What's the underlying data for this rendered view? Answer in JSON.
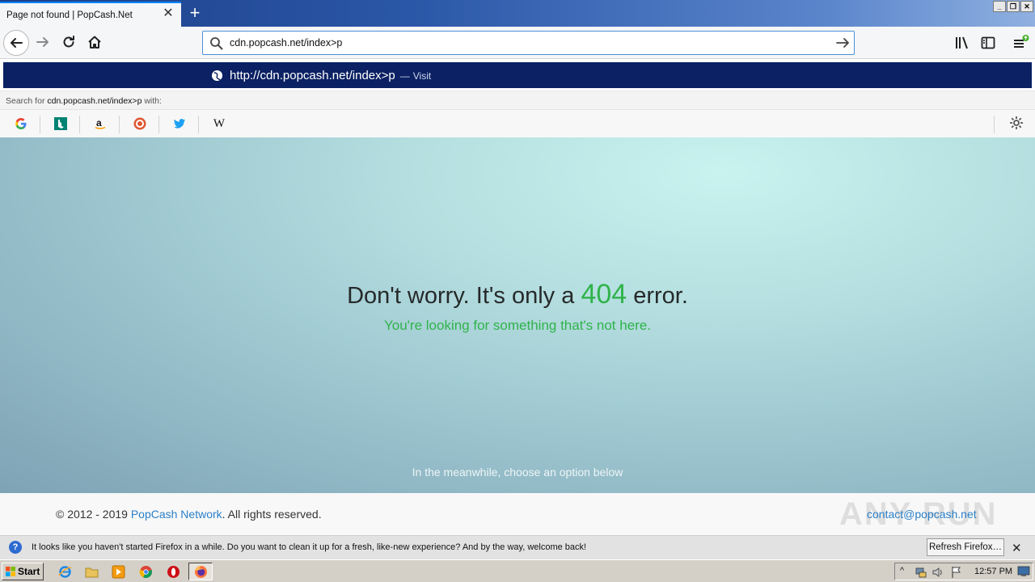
{
  "browser": {
    "tab_title": "Page not found | PopCash.Net",
    "tab_close": "✕",
    "new_tab": "+",
    "window_buttons": [
      "_",
      "❐",
      "✕"
    ],
    "url": "cdn.popcash.net/index>p",
    "autocomplete": {
      "protocol": "http://",
      "host": "cdn.popcash.net",
      "path": "/index>p",
      "separator": "—",
      "action": "Visit"
    },
    "search_for": {
      "prefix": "Search for ",
      "query": "cdn.popcash.net/index>p",
      "suffix": " with:"
    },
    "engines": [
      "google-icon",
      "bing-icon",
      "amazon-icon",
      "duckduckgo-icon",
      "twitter-icon",
      "wikipedia-icon"
    ]
  },
  "page": {
    "headline_before": "Don't worry. It's only a ",
    "headline_number": "404",
    "headline_after": " error.",
    "subline": "You're looking for something that's not here.",
    "meanwhile": "In the meanwhile, choose an option below",
    "copyright_prefix": "© 2012 - 2019 ",
    "copyright_link": "PopCash Network",
    "copyright_suffix": ". All rights reserved.",
    "contact": "contact@popcash.net",
    "watermark": "ANY RUN"
  },
  "notification": {
    "text": "It looks like you haven't started Firefox in a while. Do you want to clean it up for a fresh, like-new experience? And by the way, welcome back!",
    "button": "Refresh Firefox…",
    "close": "✕"
  },
  "taskbar": {
    "start_label": "Start",
    "clock": "12:57 PM"
  },
  "colors": {
    "accent_green": "#2fb34a",
    "link_blue": "#2a7fc9",
    "autocomplete_bg": "#0b2163"
  }
}
